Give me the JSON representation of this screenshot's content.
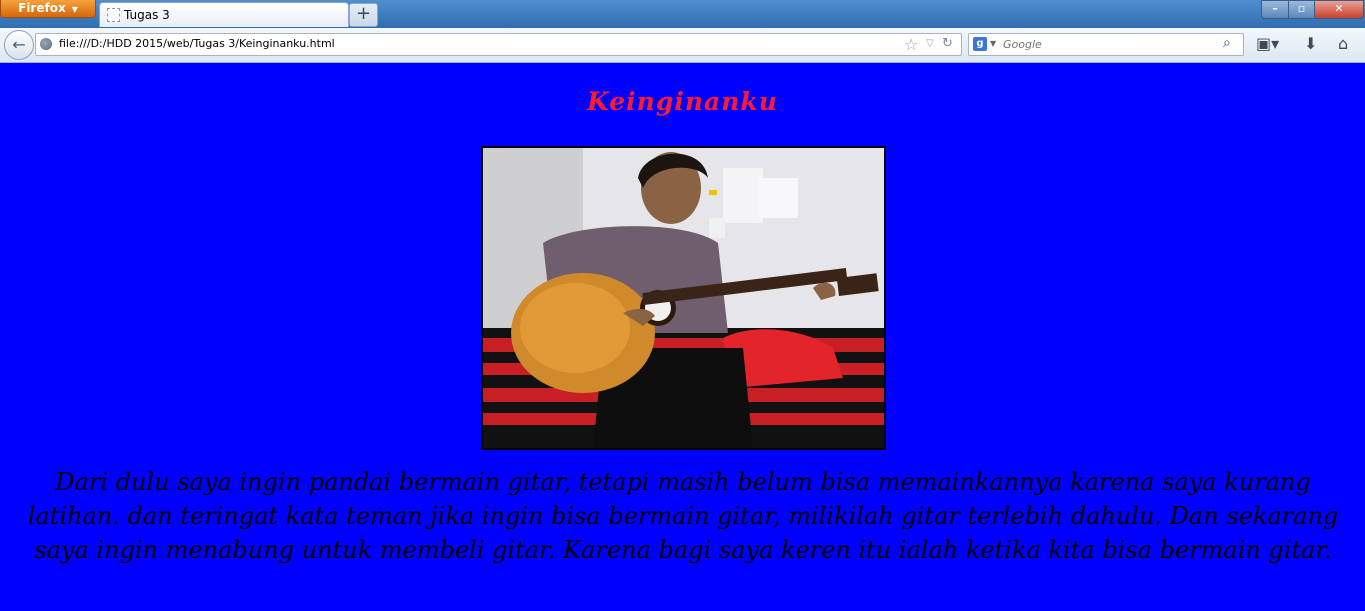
{
  "browser": {
    "app_button": "Firefox",
    "tab": {
      "title": "Tugas 3"
    },
    "new_tab_label": "+",
    "url": "file:///D:/HDD 2015/web/Tugas 3/Keinginanku.html",
    "search": {
      "engine": "g",
      "placeholder": "Google"
    },
    "window_controls": {
      "minimize": "–",
      "maximize": "▫",
      "close": "✕"
    }
  },
  "page": {
    "title": "Keinginanku",
    "paragraph": "Dari dulu saya ingin pandai bermain gitar, tetapi masih belum bisa memainkannya karena saya kurang latihan. dan teringat kata teman jika ingin bisa bermain gitar, milikilah gitar terlebih dahulu. Dan sekarang saya ingin menabung untuk membeli gitar. Karena bagi saya keren itu ialah ketika kita bisa bermain gitar.",
    "photo_subject": "boy-playing-guitar"
  },
  "colors": {
    "page_background": "#0000ff",
    "title_color": "#ff1a30",
    "text_color": "#000000"
  }
}
